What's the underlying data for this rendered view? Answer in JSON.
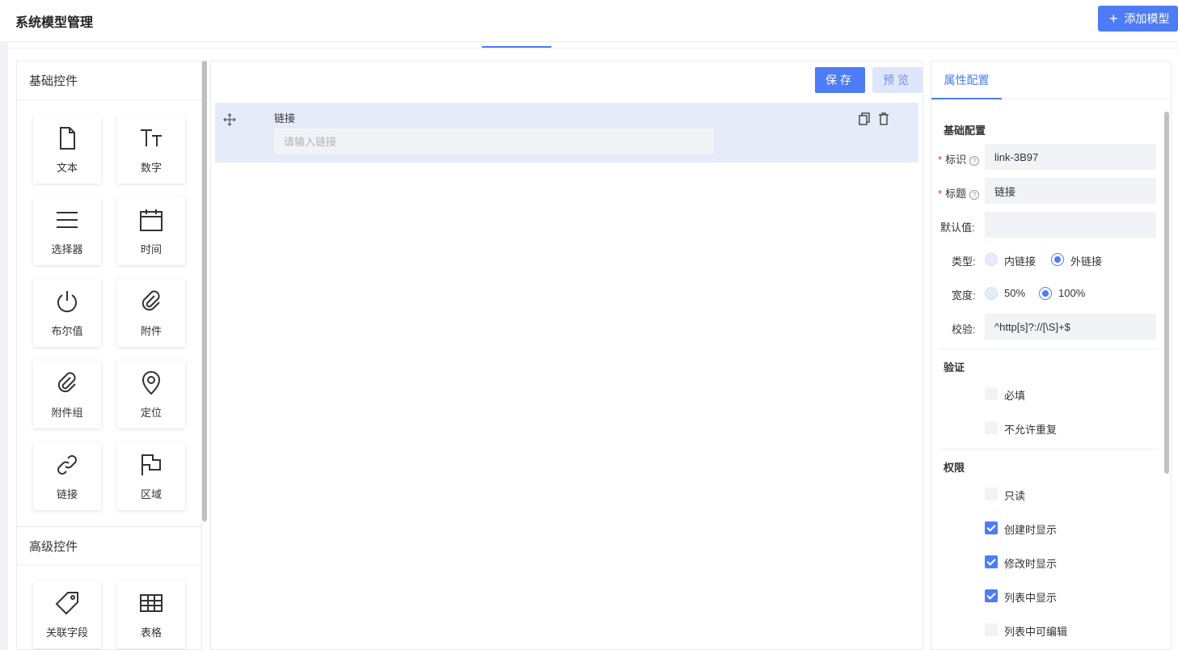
{
  "header": {
    "title": "系统模型管理",
    "add_button": "添加模型"
  },
  "left_panel": {
    "basic_title": "基础控件",
    "basic_controls": [
      {
        "label": "文本",
        "icon": "file-icon"
      },
      {
        "label": "数字",
        "icon": "text-size-icon"
      },
      {
        "label": "选择器",
        "icon": "list-icon"
      },
      {
        "label": "时间",
        "icon": "calendar-icon"
      },
      {
        "label": "布尔值",
        "icon": "power-icon"
      },
      {
        "label": "附件",
        "icon": "paperclip-icon"
      },
      {
        "label": "附件组",
        "icon": "paperclip-icon"
      },
      {
        "label": "定位",
        "icon": "location-pin-icon"
      },
      {
        "label": "链接",
        "icon": "link-icon"
      },
      {
        "label": "区域",
        "icon": "flag-icon"
      }
    ],
    "advanced_title": "高级控件",
    "advanced_controls": [
      {
        "label": "关联字段",
        "icon": "tag-icon"
      },
      {
        "label": "表格",
        "icon": "table-icon"
      }
    ]
  },
  "canvas": {
    "save_label": "保存",
    "preview_label": "预览",
    "field": {
      "label": "链接",
      "placeholder": "请输入链接"
    }
  },
  "properties": {
    "tab": "属性配置",
    "basic_section": "基础配置",
    "id_label": "标识",
    "id_value": "link-3B97",
    "title_label": "标题",
    "title_value": "链接",
    "default_label": "默认值:",
    "default_value": "",
    "type_label": "类型:",
    "type_options": [
      "内链接",
      "外链接"
    ],
    "type_selected": "外链接",
    "width_label": "宽度:",
    "width_options": [
      "50%",
      "100%"
    ],
    "width_selected": "100%",
    "validate_label": "校验:",
    "validate_value": "^http[s]?://[\\S]+$",
    "verify_section": "验证",
    "verify_options": [
      {
        "label": "必填",
        "checked": false
      },
      {
        "label": "不允许重复",
        "checked": false
      }
    ],
    "perm_section": "权限",
    "perm_options": [
      {
        "label": "只读",
        "checked": false
      },
      {
        "label": "创建时显示",
        "checked": true
      },
      {
        "label": "修改时显示",
        "checked": true
      },
      {
        "label": "列表中显示",
        "checked": true
      },
      {
        "label": "列表中可编辑",
        "checked": false
      }
    ]
  },
  "colors": {
    "accent": "#4e7cf6",
    "card_bg": "#e6ebfa"
  }
}
